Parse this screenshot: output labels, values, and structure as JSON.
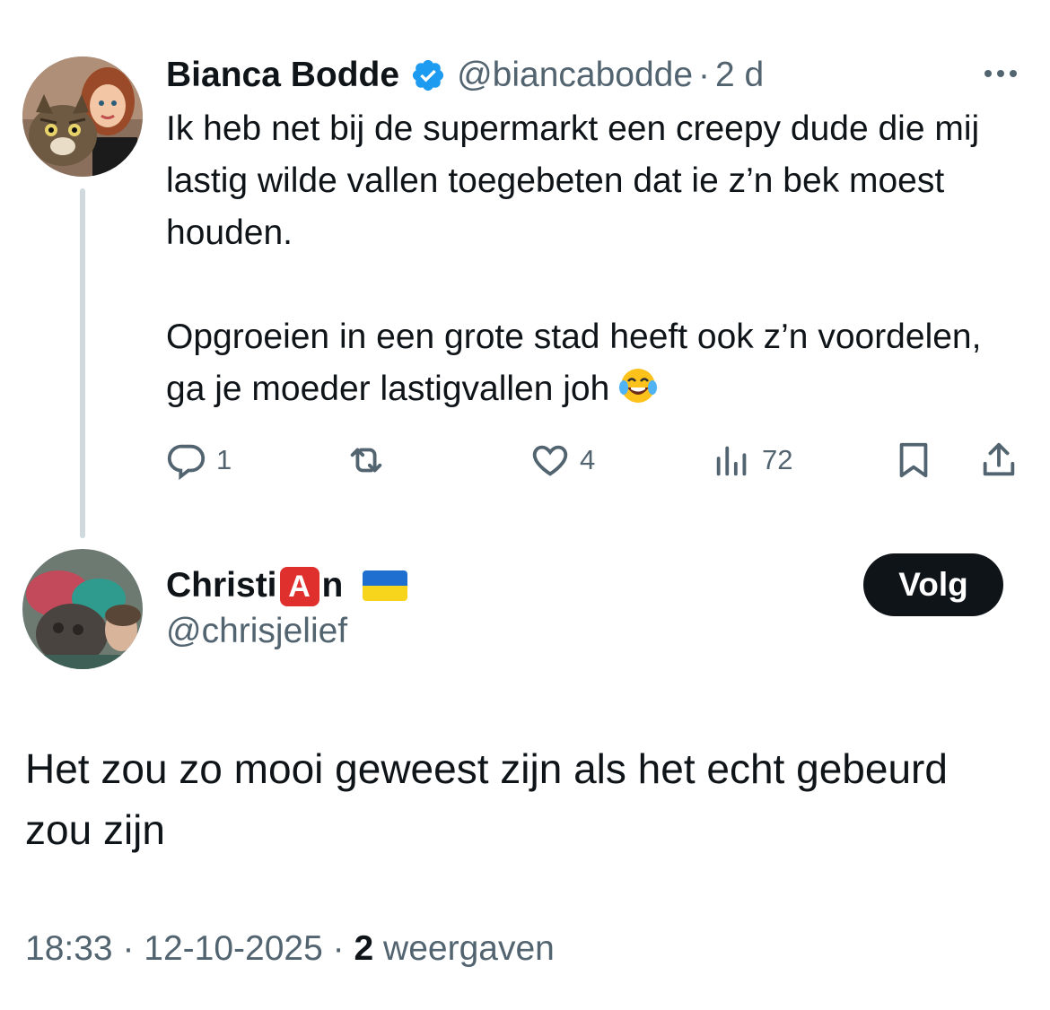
{
  "parent_tweet": {
    "author_name": "Bianca Bodde",
    "handle": "@biancabodde",
    "separator": "·",
    "time": "2 d",
    "text_lines_1": "Ik heb net bij de supermarkt een creepy dude die mij lastig wilde vallen toegebeten dat ie z’n bek moest houden.",
    "text_lines_2": "Opgroeien in een grote stad heeft ook z’n voordelen, ga je moeder lastigvallen joh",
    "emoji": "face-with-tears-of-joy",
    "replies": "1",
    "likes": "4",
    "views": "72"
  },
  "reply_tweet": {
    "author_name_part1": "Christi",
    "author_badge": "A",
    "author_name_part2": "n",
    "flag": "ukraine-flag",
    "handle": "@chrisjelief",
    "follow_label": "Volg",
    "text": "Het zou zo mooi geweest zijn als het echt gebeurd zou zijn",
    "time": "18:33",
    "date": "12-10-2025",
    "separator": "·",
    "views_count": "2",
    "views_label": "weergaven"
  },
  "colors": {
    "text": "#0f1419",
    "secondary": "#536471",
    "verified": "#1d9bf0",
    "thread_line": "#cfd9de",
    "follow_bg": "#0f1419"
  }
}
